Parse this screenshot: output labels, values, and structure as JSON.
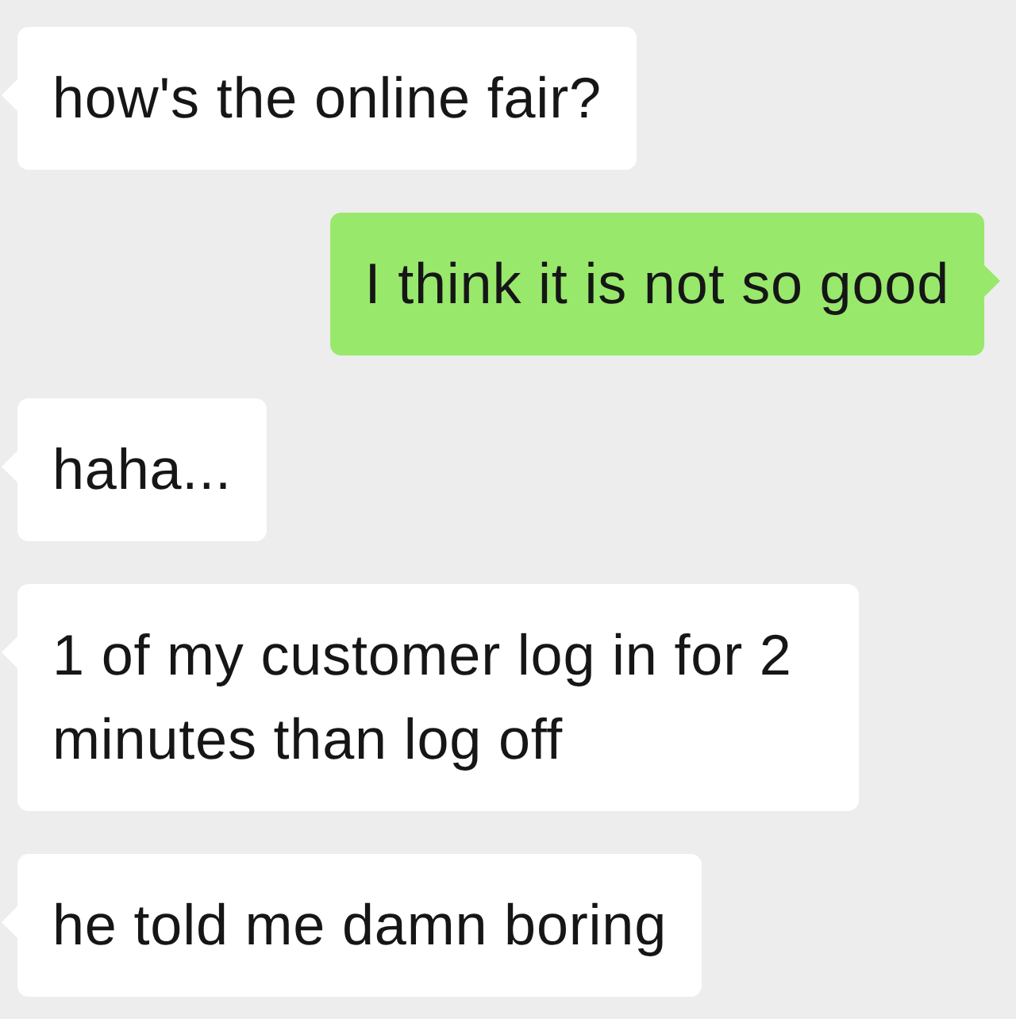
{
  "messages": [
    {
      "kind": "received",
      "text": "how's the online fair?"
    },
    {
      "kind": "sent",
      "text": "I think it is not so good"
    },
    {
      "kind": "received",
      "text": "haha..."
    },
    {
      "kind": "received",
      "text": "1 of my customer log in for 2 minutes than log off"
    },
    {
      "kind": "received",
      "text": "he told me damn boring"
    }
  ]
}
